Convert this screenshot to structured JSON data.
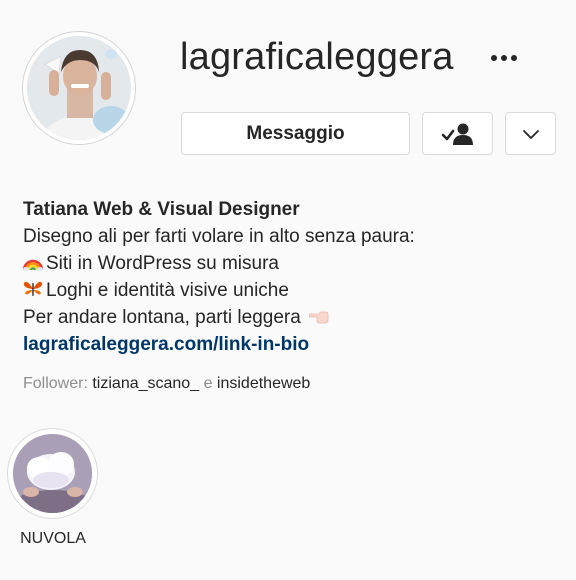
{
  "profile": {
    "username": "lagraficaleggera",
    "message_button": "Messaggio"
  },
  "icons": {
    "more": "more-options-icon",
    "follow": "following-person-check-icon",
    "suggest": "chevron-down-icon",
    "rainbow": "rainbow-icon",
    "butterfly": "butterfly-icon",
    "pointing": "pointing-left-hand-icon"
  },
  "bio": {
    "name": "Tatiana Web & Visual Designer",
    "line1": "Disegno ali per farti volare in alto senza paura:",
    "line2": "Siti in WordPress su misura",
    "line3": "Loghi e identità visive uniche",
    "line4": "Per andare lontana, parti leggera",
    "link": "lagraficaleggera.com/link-in-bio"
  },
  "followers": {
    "prefix": "Follower:",
    "account1": "tiziana_scano_",
    "conj": "e",
    "account2": "insidetheweb"
  },
  "highlights": [
    {
      "label": "NUVOLA"
    }
  ],
  "colors": {
    "link": "#00376b",
    "text": "#262626",
    "secondary": "#8e8e8e",
    "border": "#dbdbdb"
  }
}
